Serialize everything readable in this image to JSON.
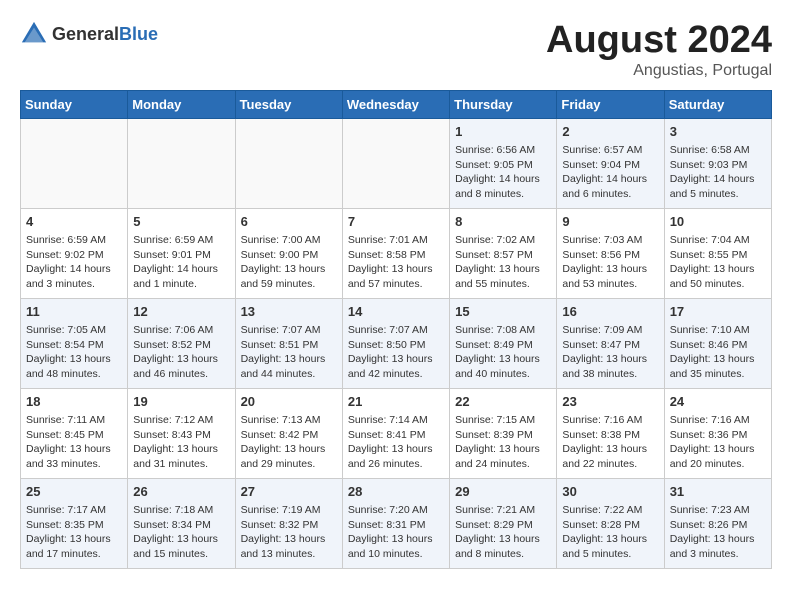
{
  "logo": {
    "general": "General",
    "blue": "Blue"
  },
  "header": {
    "month_year": "August 2024",
    "location": "Angustias, Portugal"
  },
  "weekdays": [
    "Sunday",
    "Monday",
    "Tuesday",
    "Wednesday",
    "Thursday",
    "Friday",
    "Saturday"
  ],
  "weeks": [
    [
      {
        "day": "",
        "info": ""
      },
      {
        "day": "",
        "info": ""
      },
      {
        "day": "",
        "info": ""
      },
      {
        "day": "",
        "info": ""
      },
      {
        "day": "1",
        "info": "Sunrise: 6:56 AM\nSunset: 9:05 PM\nDaylight: 14 hours and 8 minutes."
      },
      {
        "day": "2",
        "info": "Sunrise: 6:57 AM\nSunset: 9:04 PM\nDaylight: 14 hours and 6 minutes."
      },
      {
        "day": "3",
        "info": "Sunrise: 6:58 AM\nSunset: 9:03 PM\nDaylight: 14 hours and 5 minutes."
      }
    ],
    [
      {
        "day": "4",
        "info": "Sunrise: 6:59 AM\nSunset: 9:02 PM\nDaylight: 14 hours and 3 minutes."
      },
      {
        "day": "5",
        "info": "Sunrise: 6:59 AM\nSunset: 9:01 PM\nDaylight: 14 hours and 1 minute."
      },
      {
        "day": "6",
        "info": "Sunrise: 7:00 AM\nSunset: 9:00 PM\nDaylight: 13 hours and 59 minutes."
      },
      {
        "day": "7",
        "info": "Sunrise: 7:01 AM\nSunset: 8:58 PM\nDaylight: 13 hours and 57 minutes."
      },
      {
        "day": "8",
        "info": "Sunrise: 7:02 AM\nSunset: 8:57 PM\nDaylight: 13 hours and 55 minutes."
      },
      {
        "day": "9",
        "info": "Sunrise: 7:03 AM\nSunset: 8:56 PM\nDaylight: 13 hours and 53 minutes."
      },
      {
        "day": "10",
        "info": "Sunrise: 7:04 AM\nSunset: 8:55 PM\nDaylight: 13 hours and 50 minutes."
      }
    ],
    [
      {
        "day": "11",
        "info": "Sunrise: 7:05 AM\nSunset: 8:54 PM\nDaylight: 13 hours and 48 minutes."
      },
      {
        "day": "12",
        "info": "Sunrise: 7:06 AM\nSunset: 8:52 PM\nDaylight: 13 hours and 46 minutes."
      },
      {
        "day": "13",
        "info": "Sunrise: 7:07 AM\nSunset: 8:51 PM\nDaylight: 13 hours and 44 minutes."
      },
      {
        "day": "14",
        "info": "Sunrise: 7:07 AM\nSunset: 8:50 PM\nDaylight: 13 hours and 42 minutes."
      },
      {
        "day": "15",
        "info": "Sunrise: 7:08 AM\nSunset: 8:49 PM\nDaylight: 13 hours and 40 minutes."
      },
      {
        "day": "16",
        "info": "Sunrise: 7:09 AM\nSunset: 8:47 PM\nDaylight: 13 hours and 38 minutes."
      },
      {
        "day": "17",
        "info": "Sunrise: 7:10 AM\nSunset: 8:46 PM\nDaylight: 13 hours and 35 minutes."
      }
    ],
    [
      {
        "day": "18",
        "info": "Sunrise: 7:11 AM\nSunset: 8:45 PM\nDaylight: 13 hours and 33 minutes."
      },
      {
        "day": "19",
        "info": "Sunrise: 7:12 AM\nSunset: 8:43 PM\nDaylight: 13 hours and 31 minutes."
      },
      {
        "day": "20",
        "info": "Sunrise: 7:13 AM\nSunset: 8:42 PM\nDaylight: 13 hours and 29 minutes."
      },
      {
        "day": "21",
        "info": "Sunrise: 7:14 AM\nSunset: 8:41 PM\nDaylight: 13 hours and 26 minutes."
      },
      {
        "day": "22",
        "info": "Sunrise: 7:15 AM\nSunset: 8:39 PM\nDaylight: 13 hours and 24 minutes."
      },
      {
        "day": "23",
        "info": "Sunrise: 7:16 AM\nSunset: 8:38 PM\nDaylight: 13 hours and 22 minutes."
      },
      {
        "day": "24",
        "info": "Sunrise: 7:16 AM\nSunset: 8:36 PM\nDaylight: 13 hours and 20 minutes."
      }
    ],
    [
      {
        "day": "25",
        "info": "Sunrise: 7:17 AM\nSunset: 8:35 PM\nDaylight: 13 hours and 17 minutes."
      },
      {
        "day": "26",
        "info": "Sunrise: 7:18 AM\nSunset: 8:34 PM\nDaylight: 13 hours and 15 minutes."
      },
      {
        "day": "27",
        "info": "Sunrise: 7:19 AM\nSunset: 8:32 PM\nDaylight: 13 hours and 13 minutes."
      },
      {
        "day": "28",
        "info": "Sunrise: 7:20 AM\nSunset: 8:31 PM\nDaylight: 13 hours and 10 minutes."
      },
      {
        "day": "29",
        "info": "Sunrise: 7:21 AM\nSunset: 8:29 PM\nDaylight: 13 hours and 8 minutes."
      },
      {
        "day": "30",
        "info": "Sunrise: 7:22 AM\nSunset: 8:28 PM\nDaylight: 13 hours and 5 minutes."
      },
      {
        "day": "31",
        "info": "Sunrise: 7:23 AM\nSunset: 8:26 PM\nDaylight: 13 hours and 3 minutes."
      }
    ]
  ]
}
